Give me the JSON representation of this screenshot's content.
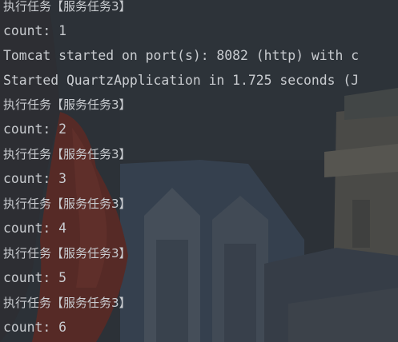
{
  "console": {
    "lines": [
      "执行任务【服务任务3】",
      "count: 1",
      "Tomcat started on port(s): 8082 (http) with c",
      "Started QuartzApplication in 1.725 seconds (J",
      "执行任务【服务任务3】",
      "count: 2",
      "执行任务【服务任务3】",
      "count: 3",
      "执行任务【服务任务3】",
      "count: 4",
      "执行任务【服务任务3】",
      "count: 5",
      "执行任务【服务任务3】",
      "count: 6"
    ]
  },
  "colors": {
    "text": "#c9ccd0",
    "background_dark": "#2c3136",
    "accent_red": "#7a2a22"
  }
}
